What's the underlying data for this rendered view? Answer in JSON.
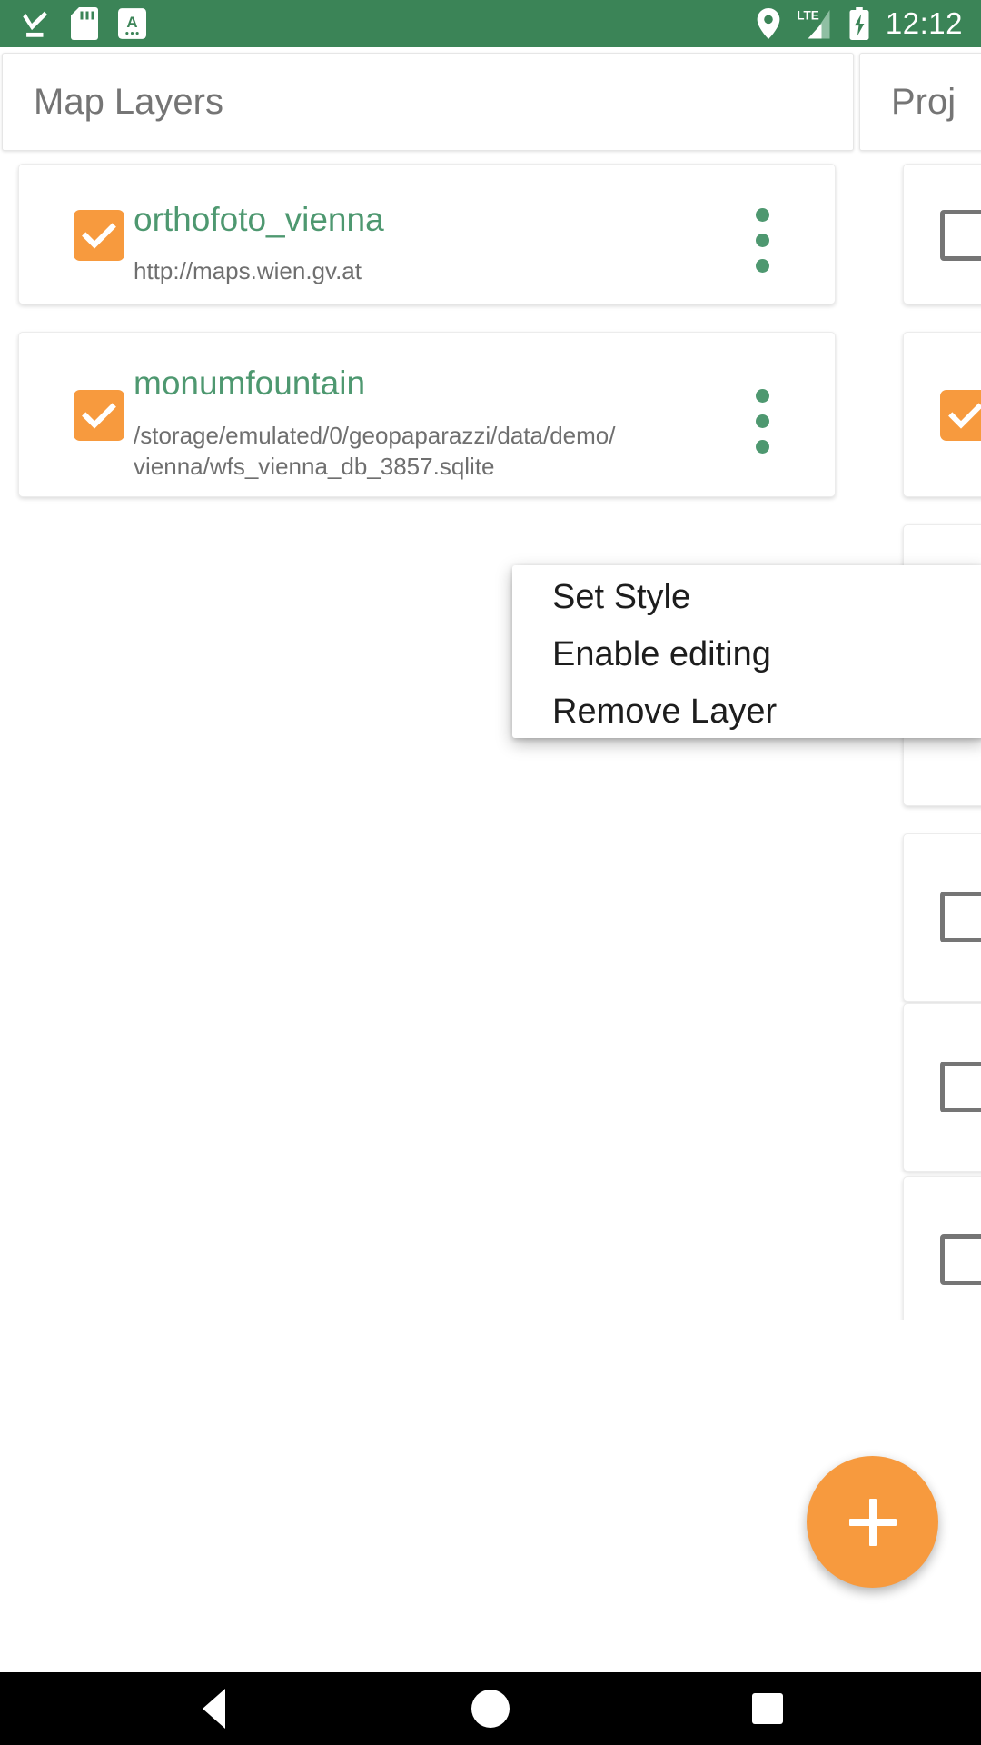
{
  "statusbar": {
    "background": "#3b8457",
    "clock": "12:12",
    "left_icons": [
      "download-complete-icon",
      "sd-card-icon",
      "screenshot-a-icon"
    ],
    "right_icons": [
      "location-pin-icon",
      "lte-signal-icon",
      "battery-charging-icon"
    ],
    "network_label": "LTE"
  },
  "tabs": [
    {
      "id": "map-layers",
      "label": "Map Layers",
      "selected": true
    },
    {
      "id": "projects",
      "label": "Proj",
      "selected": false
    }
  ],
  "layers": [
    {
      "name": "orthofoto_vienna",
      "source": "http://maps.wien.gv.at",
      "checked": true,
      "name_color": "#4e9870",
      "checkbox_color": "#F79A3E"
    },
    {
      "name": "monumfountain",
      "source": "/storage/emulated/0/geopaparazzi/data/demo/\nvienna/wfs_vienna_db_3857.sqlite",
      "checked": true,
      "name_color": "#4e9870",
      "checkbox_color": "#F79A3E"
    }
  ],
  "context_menu": {
    "visible": true,
    "items": [
      {
        "label": "Set Style"
      },
      {
        "label": "Enable editing"
      },
      {
        "label": "Remove Layer"
      }
    ]
  },
  "projects_column": {
    "items": [
      {
        "checked": false
      },
      {
        "checked": true
      },
      {
        "checked": false
      },
      {
        "checked": false
      },
      {
        "checked": false
      },
      {
        "checked": false
      }
    ]
  },
  "fab": {
    "icon": "plus-icon",
    "color": "#F79A3E"
  },
  "navbar": {
    "background": "#000000",
    "buttons": [
      {
        "id": "back",
        "icon": "back-triangle-icon"
      },
      {
        "id": "home",
        "icon": "home-circle-icon"
      },
      {
        "id": "recents",
        "icon": "recents-square-icon"
      }
    ]
  }
}
